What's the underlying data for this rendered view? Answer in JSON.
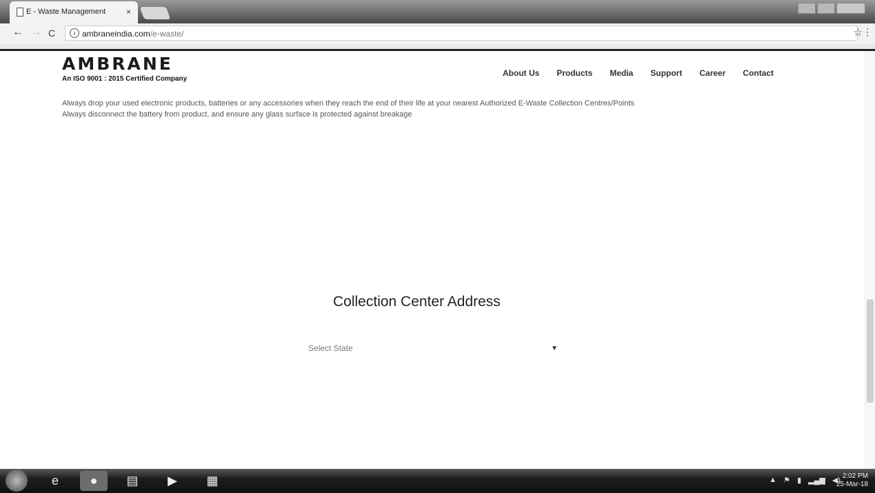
{
  "browser": {
    "tab_title": "E - Waste Management",
    "tab_close": "×",
    "url_domain": "ambraneindia.com",
    "url_path": "/e-waste/",
    "back_icon": "←",
    "forward_icon": "→",
    "reload_icon": "C",
    "star_icon": "☆",
    "menu_icon": "⋮"
  },
  "header": {
    "logo": "AMBRANE",
    "tagline": "An ISO 9001 : 2015 Certified Company",
    "nav": [
      "About Us",
      "Products",
      "Media",
      "Support",
      "Career",
      "Contact"
    ]
  },
  "intro": {
    "line1": "Always drop your used electronic products, batteries or any accessories when they reach the end of their life at your nearest Authorized E-Waste Collection Centres/Points",
    "line2": "Always disconnect the battery from product, and ensure any glass surface is protected against breakage"
  },
  "collection": {
    "heading": "Collection Center Address",
    "select_placeholder": "Select State"
  },
  "taskbar": {
    "clock_time": "2:02 PM",
    "clock_date": "25-Mar-18"
  }
}
